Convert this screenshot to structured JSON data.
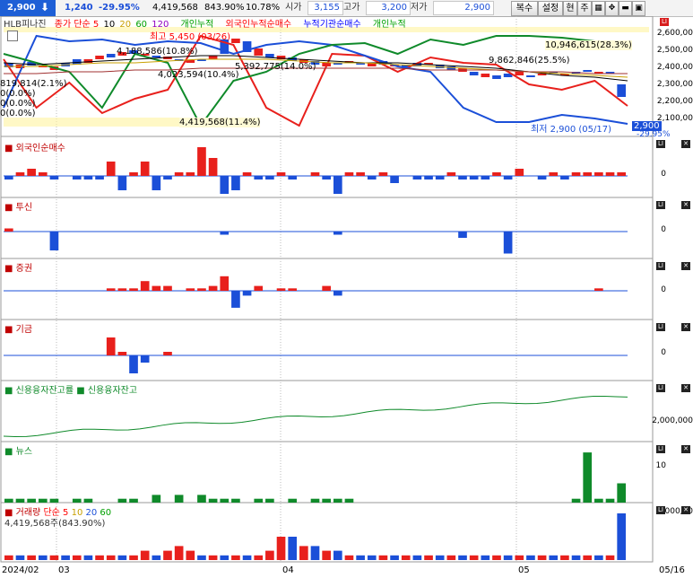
{
  "topbar": {
    "price": "2,900",
    "arrow": "⬇",
    "change": "1,240",
    "change_pct": "-29.95%",
    "volume": "4,419,568",
    "volume_ratio": "843.90%",
    "turnover": "10.78%",
    "open_label": "시가",
    "open_value": "3,155",
    "high_label": "고가",
    "high_value": "3,200",
    "low_label": "저가",
    "low_value": "2,900",
    "btn_copy": "복수",
    "btn_settings": "설정",
    "btn_current": "현",
    "btn_week": "주"
  },
  "price_pane": {
    "stock_name": "HLB피나진",
    "ma_label": "종가 단순 5",
    "ma_periods": [
      "10",
      "20",
      "60",
      "120"
    ],
    "ma_colors": [
      "#ff0000",
      "#c8a000",
      "#00a000",
      "#9000c0"
    ],
    "legend_items": [
      {
        "label": "개인누적",
        "color": "#00a000"
      },
      {
        "label": "외국인누적순매수",
        "color": "#ff0000"
      },
      {
        "label": "누적기관순매수",
        "color": "#0000ff"
      },
      {
        "label": "개인누적",
        "color": "#00a000"
      }
    ],
    "annotations": {
      "high": "최고 5,450 (03/26)",
      "low": "최저 2,900 (05/17)",
      "a1": "10,946,615(28.3%)",
      "a2": "9,862,846(25.5%)",
      "a3": "5,392,775(14.0%)",
      "a4": "4,023,594(10.4%)",
      "a5": "4,419,568(11.4%)",
      "a6": "4,188,586(10.8%)",
      "a7": "819,814(2.1%)",
      "a8": "0(0.0%)",
      "a9": "0(0.0%)",
      "a10": "0(0.0%)",
      "last_price": "2,900",
      "last_pct": "-29.95%"
    },
    "y_ticks": [
      "2,600,00",
      "2,500,00",
      "2,400,00",
      "2,300,00",
      "2,200,00",
      "2,100,00"
    ]
  },
  "panes": [
    {
      "title": "외국인순매수",
      "zero": "0"
    },
    {
      "title": "투신",
      "zero": "0"
    },
    {
      "title": "증권",
      "zero": "0"
    },
    {
      "title": "기금",
      "zero": "0"
    }
  ],
  "credit_pane": {
    "title1": "신용융자잔고률",
    "title2": "신용융자잔고",
    "tick": "2,000,000"
  },
  "news_pane": {
    "title": "뉴스",
    "tick": "10"
  },
  "volume_pane": {
    "title": "거래량",
    "ma_label": "단순 5",
    "ma_periods": [
      "10",
      "20",
      "60"
    ],
    "last_volume": "4,419,568주(843.90%)",
    "tick": "5,000,00"
  },
  "x_axis": [
    "2024/02",
    "03",
    "04",
    "05",
    "05/16"
  ],
  "colors": {
    "up": "#e8201c",
    "down": "#1b4fd8",
    "news": "#0f8a2a"
  },
  "chart_data": [
    {
      "type": "bar",
      "title": "외국인순매수",
      "values": [
        -1,
        1,
        2,
        1,
        -1,
        0,
        -1,
        -1,
        -1,
        4,
        -4,
        1,
        4,
        -4,
        -1,
        1,
        1,
        8,
        5,
        -5,
        -4,
        1,
        -1,
        -1,
        1,
        -1,
        0,
        1,
        -1,
        -5,
        1,
        1,
        -1,
        1,
        -2,
        0,
        -1,
        -1,
        -1,
        1,
        -1,
        -1,
        -1,
        1,
        -1,
        2,
        0,
        -1,
        1,
        -1,
        1,
        1,
        1,
        1,
        1
      ]
    },
    {
      "type": "bar",
      "title": "투신",
      "values": [
        1,
        0,
        0,
        0,
        -6,
        0,
        0,
        0,
        0,
        0,
        0,
        0,
        0,
        0,
        0,
        0,
        0,
        0,
        0,
        -1,
        0,
        0,
        0,
        0,
        0,
        0,
        0,
        0,
        0,
        -1,
        0,
        0,
        0,
        0,
        0,
        0,
        0,
        0,
        0,
        0,
        -2,
        0,
        0,
        0,
        -7,
        0,
        0,
        0,
        0,
        0,
        0,
        0,
        0,
        0,
        0
      ]
    },
    {
      "type": "bar",
      "title": "증권",
      "values": [
        0,
        0,
        0,
        0,
        0,
        0,
        0,
        0,
        0,
        1,
        1,
        1,
        4,
        2,
        2,
        0,
        1,
        1,
        2,
        6,
        -7,
        -2,
        2,
        0,
        1,
        1,
        0,
        0,
        2,
        -2,
        0,
        0,
        0,
        0,
        0,
        0,
        0,
        0,
        0,
        0,
        0,
        0,
        0,
        0,
        0,
        0,
        0,
        0,
        0,
        0,
        0,
        0,
        1,
        0,
        0
      ]
    },
    {
      "type": "bar",
      "title": "기금",
      "values": [
        0,
        0,
        0,
        0,
        0,
        0,
        0,
        0,
        0,
        5,
        1,
        -5,
        -2,
        0,
        1,
        0,
        0,
        0,
        0,
        0,
        0,
        0,
        0,
        0,
        0,
        0,
        0,
        0,
        0,
        0,
        0,
        0,
        0,
        0,
        0,
        0,
        0,
        0,
        0,
        0,
        0,
        0,
        0,
        0,
        0,
        0,
        0,
        0,
        0,
        0,
        0,
        0,
        0,
        0,
        0
      ]
    },
    {
      "type": "bar",
      "title": "뉴스",
      "values": [
        1,
        1,
        1,
        1,
        1,
        0,
        1,
        1,
        0,
        0,
        1,
        1,
        0,
        2,
        0,
        2,
        0,
        2,
        1,
        1,
        1,
        0,
        1,
        1,
        0,
        1,
        0,
        1,
        1,
        1,
        1,
        0,
        0,
        0,
        0,
        0,
        0,
        0,
        0,
        0,
        0,
        0,
        0,
        0,
        0,
        0,
        0,
        0,
        0,
        0,
        1,
        13,
        1,
        1,
        5
      ]
    }
  ]
}
